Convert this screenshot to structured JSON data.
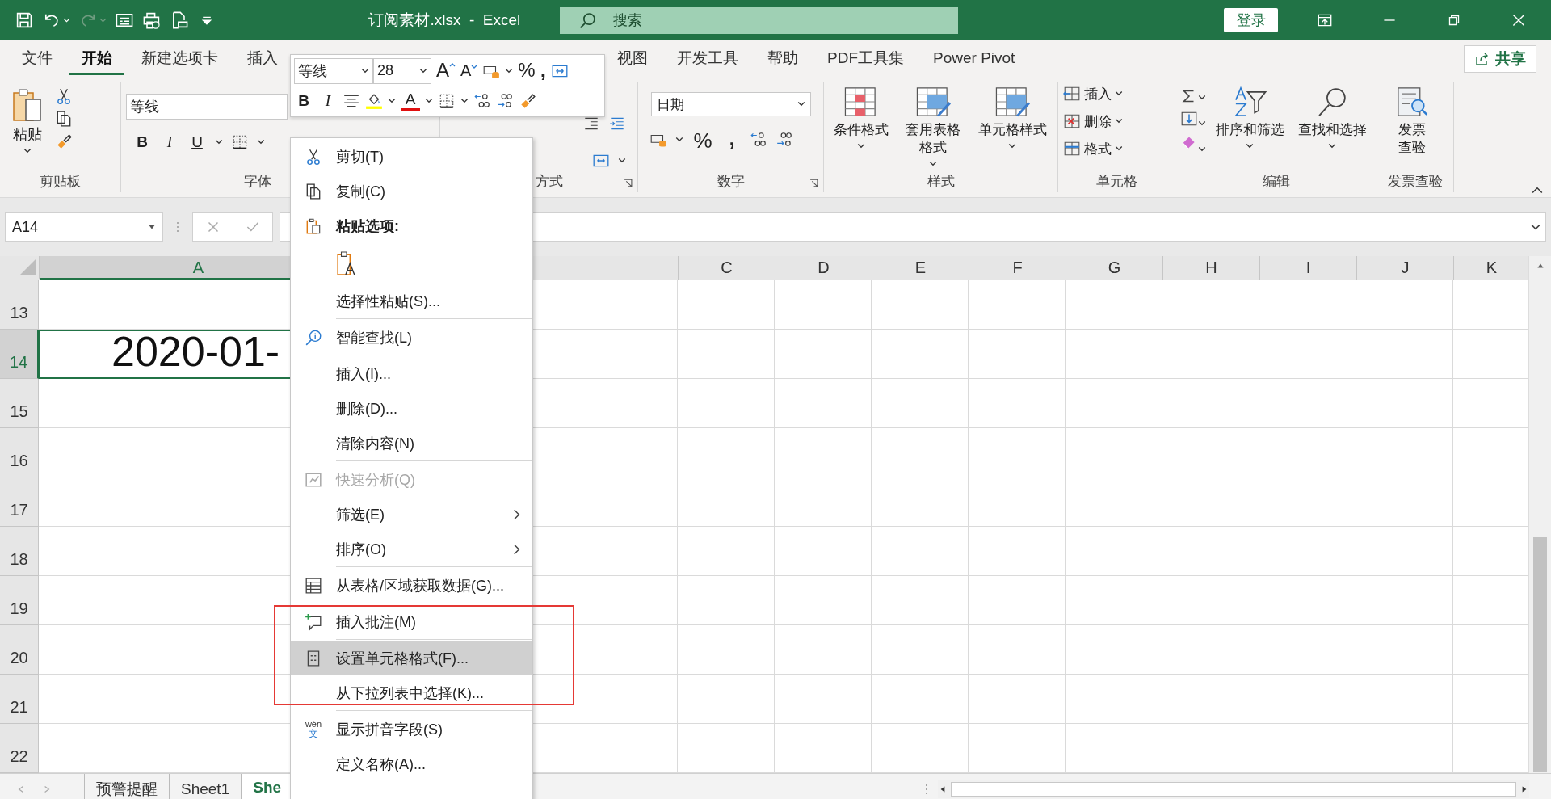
{
  "title_bar": {
    "title": "订阅素材.xlsx  -  Excel",
    "search": {
      "placeholder": "搜索"
    },
    "login": "登录"
  },
  "ribbon_tabs": [
    {
      "label": "文件",
      "selected": false
    },
    {
      "label": "开始",
      "selected": true
    },
    {
      "label": "新建选项卡",
      "selected": false
    },
    {
      "label": "插入",
      "selected": false
    },
    {
      "label": "视图",
      "selected": false
    },
    {
      "label": "开发工具",
      "selected": false
    },
    {
      "label": "帮助",
      "selected": false
    },
    {
      "label": "PDF工具集",
      "selected": false
    },
    {
      "label": "Power Pivot",
      "selected": false
    }
  ],
  "share": "共享",
  "ribbon": {
    "clipboard": {
      "paste": "粘贴",
      "label": "剪贴板"
    },
    "font": {
      "font_name": "等线",
      "bold": "B",
      "italic": "I",
      "underline": "U",
      "label": "字体"
    },
    "alignment": {
      "label": "方式"
    },
    "number": {
      "format": "日期",
      "percent": "%",
      "comma": ",",
      "label": "数字"
    },
    "styles": {
      "buttons": [
        "条件格式",
        "套用表格格式",
        "单元格样式"
      ],
      "label": "样式"
    },
    "cells": {
      "buttons": [
        "插入",
        "删除",
        "格式"
      ],
      "label": "单元格"
    },
    "editing": {
      "buttons": [
        "排序和筛选",
        "查找和选择"
      ],
      "label": "编辑"
    },
    "invoice": {
      "button": "发票查验",
      "label": "发票查验"
    }
  },
  "formula_bar": {
    "name_box": "A14"
  },
  "columns": [
    {
      "label": "A",
      "selected": true
    },
    {
      "selected": false
    },
    {
      "label": "C",
      "selected": false
    },
    {
      "label": "D",
      "selected": false
    },
    {
      "label": "E",
      "selected": false
    },
    {
      "label": "F",
      "selected": false
    },
    {
      "label": "G",
      "selected": false
    },
    {
      "label": "H",
      "selected": false
    },
    {
      "label": "I",
      "selected": false
    },
    {
      "label": "J",
      "selected": false
    },
    {
      "label": "K",
      "selected": false
    }
  ],
  "rows": [
    {
      "number": "13",
      "selected": false
    },
    {
      "number": "14",
      "selected": true,
      "value": "2020-01-"
    },
    {
      "number": "15",
      "selected": false
    },
    {
      "number": "16",
      "selected": false
    },
    {
      "number": "17",
      "selected": false
    },
    {
      "number": "18",
      "selected": false
    },
    {
      "number": "19",
      "selected": false
    },
    {
      "number": "20",
      "selected": false
    },
    {
      "number": "21",
      "selected": false
    },
    {
      "number": "22",
      "selected": false
    }
  ],
  "sheet_tabs": [
    {
      "label": "预警提醒",
      "selected": false
    },
    {
      "label": "Sheet1",
      "selected": false
    },
    {
      "label": "She",
      "selected": true
    }
  ],
  "mini_toolbar": {
    "font": "等线",
    "size": "28",
    "grow": "A",
    "shrink": "A",
    "percent": "%",
    "comma": ",",
    "bold": "B",
    "italic": "I",
    "font_color": "A"
  },
  "context_menu": [
    {
      "kind": "item",
      "label": "剪切(T)",
      "disabled": false,
      "submenu": false,
      "highlighted": false
    },
    {
      "kind": "item",
      "label": "复制(C)",
      "disabled": false,
      "submenu": false,
      "highlighted": false
    },
    {
      "kind": "header",
      "label": "粘贴选项:"
    },
    {
      "kind": "paste_options"
    },
    {
      "kind": "item",
      "label": "选择性粘贴(S)...",
      "disabled": false,
      "submenu": false,
      "highlighted": false
    },
    {
      "kind": "separator"
    },
    {
      "kind": "item",
      "label": "智能查找(L)",
      "disabled": false,
      "submenu": false,
      "highlighted": false
    },
    {
      "kind": "separator"
    },
    {
      "kind": "item",
      "label": "插入(I)...",
      "disabled": false,
      "submenu": false,
      "highlighted": false
    },
    {
      "kind": "item",
      "label": "删除(D)...",
      "disabled": false,
      "submenu": false,
      "highlighted": false
    },
    {
      "kind": "item",
      "label": "清除内容(N)",
      "disabled": false,
      "submenu": false,
      "highlighted": false
    },
    {
      "kind": "separator"
    },
    {
      "kind": "item",
      "label": "快速分析(Q)",
      "disabled": true,
      "submenu": false,
      "highlighted": false
    },
    {
      "kind": "item",
      "label": "筛选(E)",
      "disabled": false,
      "submenu": true,
      "highlighted": false
    },
    {
      "kind": "item",
      "label": "排序(O)",
      "disabled": false,
      "submenu": true,
      "highlighted": false
    },
    {
      "kind": "separator"
    },
    {
      "kind": "item",
      "label": "从表格/区域获取数据(G)...",
      "disabled": false,
      "submenu": false,
      "highlighted": false
    },
    {
      "kind": "separator"
    },
    {
      "kind": "item",
      "label": "插入批注(M)",
      "disabled": false,
      "submenu": false,
      "highlighted": false
    },
    {
      "kind": "separator"
    },
    {
      "kind": "item",
      "label": "设置单元格格式(F)...",
      "disabled": false,
      "submenu": false,
      "highlighted": true
    },
    {
      "kind": "item",
      "label": "从下拉列表中选择(K)...",
      "disabled": false,
      "submenu": false,
      "highlighted": false
    },
    {
      "kind": "separator"
    },
    {
      "kind": "item",
      "label": "显示拼音字段(S)",
      "disabled": false,
      "submenu": false,
      "highlighted": false,
      "glyph_top": "wén",
      "glyph_bottom": "文"
    },
    {
      "kind": "item",
      "label": "定义名称(A)...",
      "disabled": false,
      "submenu": false,
      "highlighted": false
    }
  ]
}
